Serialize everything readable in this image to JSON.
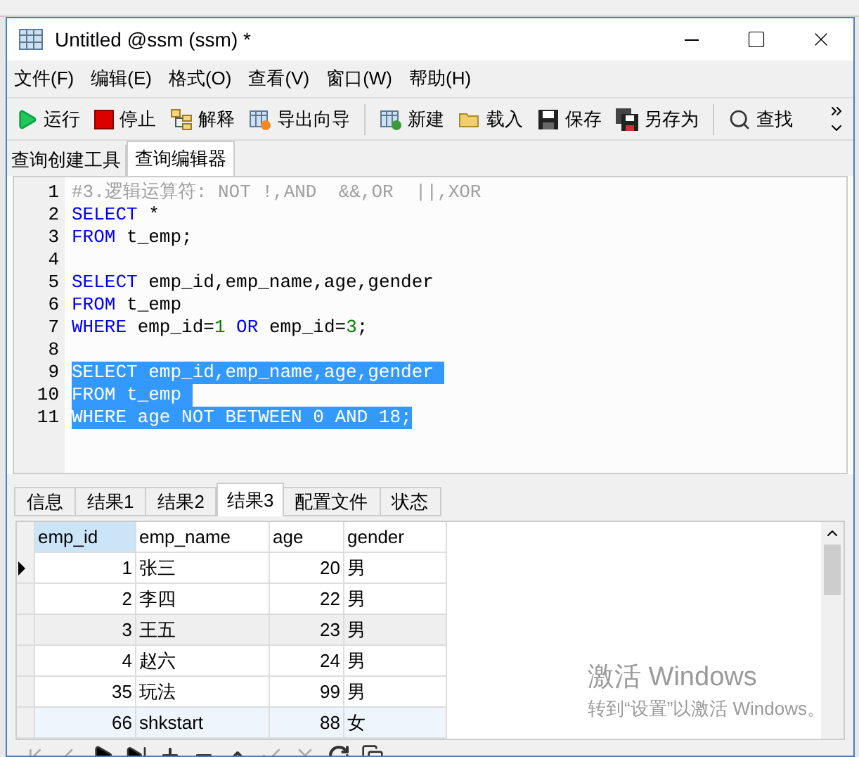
{
  "window": {
    "title": "Untitled @ssm (ssm) *"
  },
  "menu": [
    "文件(F)",
    "编辑(E)",
    "格式(O)",
    "查看(V)",
    "窗口(W)",
    "帮助(H)"
  ],
  "toolbar": [
    {
      "kind": "run",
      "label": "运行"
    },
    {
      "kind": "stop",
      "label": "停止"
    },
    {
      "kind": "explain",
      "label": "解释"
    },
    {
      "kind": "export",
      "label": "导出向导"
    },
    {
      "kind": "separator"
    },
    {
      "kind": "new",
      "label": "新建"
    },
    {
      "kind": "open",
      "label": "载入"
    },
    {
      "kind": "save",
      "label": "保存"
    },
    {
      "kind": "saveas",
      "label": "另存为"
    },
    {
      "kind": "separator"
    },
    {
      "kind": "find",
      "label": "查找"
    }
  ],
  "tabs": [
    {
      "label": "查询创建工具",
      "selected": false
    },
    {
      "label": "查询编辑器",
      "selected": true
    }
  ],
  "editor": {
    "lines": [
      {
        "number": "1",
        "selected": false,
        "tokens": [
          {
            "kind": "comment",
            "text": "#3.逻辑运算符: NOT !,AND  &&,OR  ||,XOR"
          }
        ]
      },
      {
        "number": "2",
        "selected": false,
        "tokens": [
          {
            "kind": "keyword",
            "text": "SELECT"
          },
          {
            "kind": "text",
            "text": " *"
          }
        ]
      },
      {
        "number": "3",
        "selected": false,
        "tokens": [
          {
            "kind": "keyword",
            "text": "FROM"
          },
          {
            "kind": "text",
            "text": " t_emp;"
          }
        ]
      },
      {
        "number": "4"
      },
      {
        "number": "5",
        "selected": false,
        "tokens": [
          {
            "kind": "keyword",
            "text": "SELECT"
          },
          {
            "kind": "text",
            "text": " emp_id,emp_name,age,gender"
          }
        ]
      },
      {
        "number": "6",
        "selected": false,
        "tokens": [
          {
            "kind": "keyword",
            "text": "FROM"
          },
          {
            "kind": "text",
            "text": " t_emp"
          }
        ]
      },
      {
        "number": "7",
        "selected": false,
        "tokens": [
          {
            "kind": "keyword",
            "text": "WHERE"
          },
          {
            "kind": "text",
            "text": " emp_id="
          },
          {
            "kind": "number",
            "text": "1"
          },
          {
            "kind": "keyword",
            "text": " OR"
          },
          {
            "kind": "text",
            "text": " emp_id="
          },
          {
            "kind": "number",
            "text": "3"
          },
          {
            "kind": "text",
            "text": ";"
          }
        ]
      },
      {
        "number": "8"
      },
      {
        "number": "9",
        "selected": true,
        "tokens": [
          {
            "text": "SELECT emp_id,emp_name,age,gender "
          }
        ]
      },
      {
        "number": "10",
        "selected": true,
        "tokens": [
          {
            "text": "FROM t_emp "
          }
        ]
      },
      {
        "number": "11",
        "selected": true,
        "tokens": [
          {
            "text": "WHERE age NOT BETWEEN 0 AND 18;"
          }
        ]
      }
    ]
  },
  "result_tabs": [
    {
      "label": "信息",
      "selected": false
    },
    {
      "label": "结果1",
      "selected": false
    },
    {
      "label": "结果2",
      "selected": false
    },
    {
      "label": "结果3",
      "selected": true
    },
    {
      "label": "配置文件",
      "selected": false
    },
    {
      "label": "状态",
      "selected": false
    }
  ],
  "table": {
    "columns": [
      {
        "label": "emp_id",
        "selected": true
      },
      {
        "label": "emp_name",
        "selected": false
      },
      {
        "label": "age",
        "selected": false
      },
      {
        "label": "gender",
        "selected": false
      }
    ],
    "rows": [
      {
        "current": true,
        "hovered": false,
        "selected": false,
        "cells": [
          "1",
          "张三",
          "20",
          "男"
        ]
      },
      {
        "current": false,
        "hovered": false,
        "selected": false,
        "cells": [
          "2",
          "李四",
          "22",
          "男"
        ]
      },
      {
        "current": false,
        "hovered": true,
        "selected": false,
        "cells": [
          "3",
          "王五",
          "23",
          "男"
        ]
      },
      {
        "current": false,
        "hovered": false,
        "selected": false,
        "cells": [
          "4",
          "赵六",
          "24",
          "男"
        ]
      },
      {
        "current": false,
        "hovered": false,
        "selected": false,
        "cells": [
          "35",
          "玩法",
          "99",
          "男"
        ]
      },
      {
        "current": false,
        "hovered": false,
        "selected": true,
        "cells": [
          "66",
          "shkstart",
          "88",
          "女"
        ]
      }
    ]
  },
  "activation_notice": {
    "title": "激活 Windows",
    "subtitle": "转到“设置”以激活 Windows。"
  }
}
